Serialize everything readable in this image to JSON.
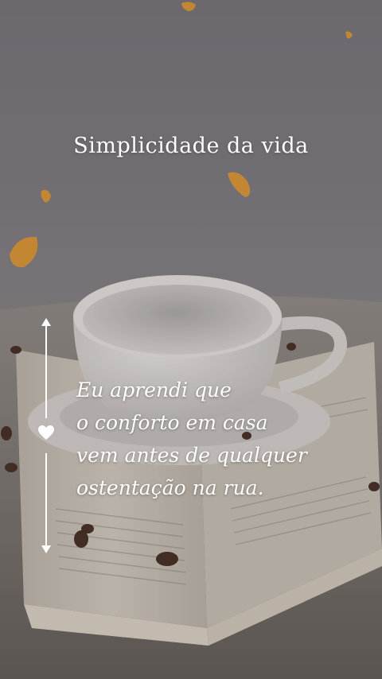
{
  "title": "Simplicidade da vida",
  "quote": {
    "lines": [
      "Eu aprendi que",
      "o conforto em casa",
      "vem antes de qualquer",
      "ostentação na rua."
    ]
  },
  "icons": {
    "divider": "heart-icon",
    "divider_arrows": [
      "arrow-up-icon",
      "arrow-down-icon"
    ]
  },
  "colors": {
    "text": "#ffffff",
    "background": "#777479",
    "cup": "#dcd8d4",
    "book_pages": "#c9c1b4",
    "leaf": "#d9922a",
    "coffee_bean": "#3b2418"
  }
}
